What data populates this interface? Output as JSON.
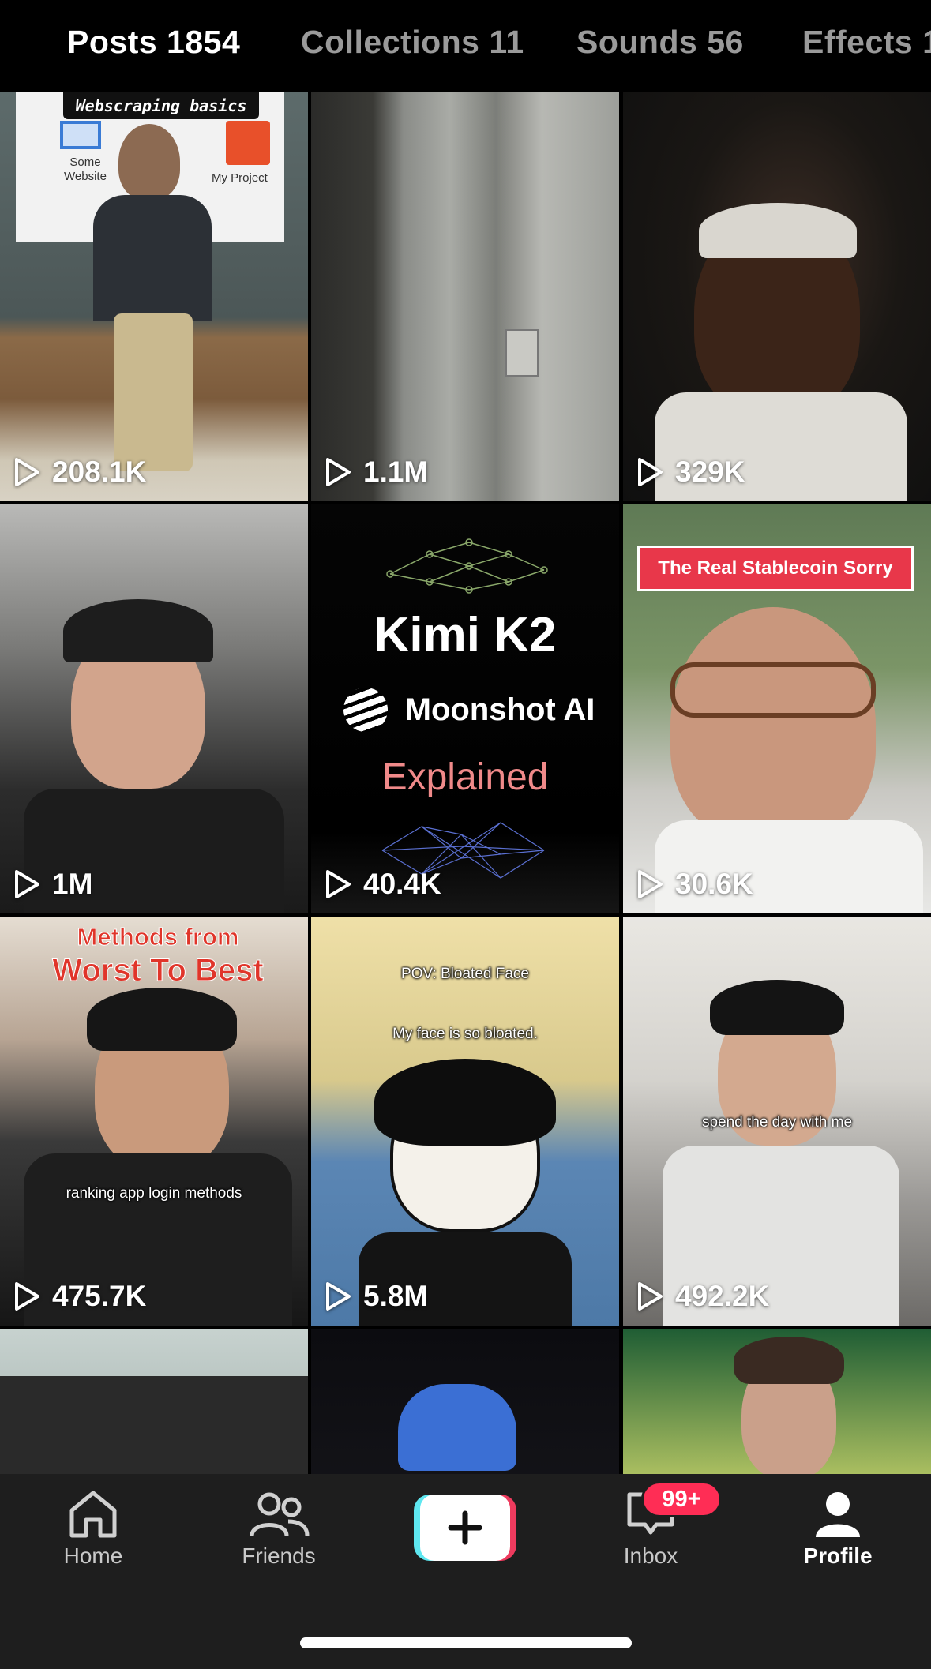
{
  "tabs": [
    {
      "label": "Posts 1854",
      "active": true
    },
    {
      "label": "Collections 11",
      "active": false
    },
    {
      "label": "Sounds 56",
      "active": false
    },
    {
      "label": "Effects 1",
      "active": false
    }
  ],
  "grid": {
    "tiles": [
      {
        "views": "208.1K",
        "overlay": {
          "label": "Webscraping basics",
          "left": "Some Website",
          "right": "My Project"
        }
      },
      {
        "views": "1.1M"
      },
      {
        "views": "329K"
      },
      {
        "views": "1M"
      },
      {
        "views": "40.4K",
        "overlay": {
          "title": "Kimi K2",
          "brand": "Moonshot AI",
          "subtitle": "Explained"
        }
      },
      {
        "views": "30.6K",
        "overlay": {
          "banner": "The Real Stablecoin Sorry"
        }
      },
      {
        "views": "475.7K",
        "overlay": {
          "line1": "Methods from",
          "line2": "Worst To Best",
          "caption": "ranking app login methods"
        }
      },
      {
        "views": "5.8M",
        "overlay": {
          "caption1": "POV: Bloated Face",
          "caption2": "My face is so bloated."
        }
      },
      {
        "views": "492.2K",
        "overlay": {
          "caption": "spend the day with me"
        }
      },
      {
        "views": ""
      },
      {
        "views": ""
      },
      {
        "views": ""
      }
    ]
  },
  "bottom_nav": {
    "home": "Home",
    "friends": "Friends",
    "inbox": "Inbox",
    "inbox_badge": "99+",
    "profile": "Profile"
  },
  "colors": {
    "background": "#000000",
    "nav_background": "#1e1e1e",
    "badge": "#ff2d55",
    "create_left": "#5ee7f0",
    "create_right": "#ee3b5e"
  }
}
